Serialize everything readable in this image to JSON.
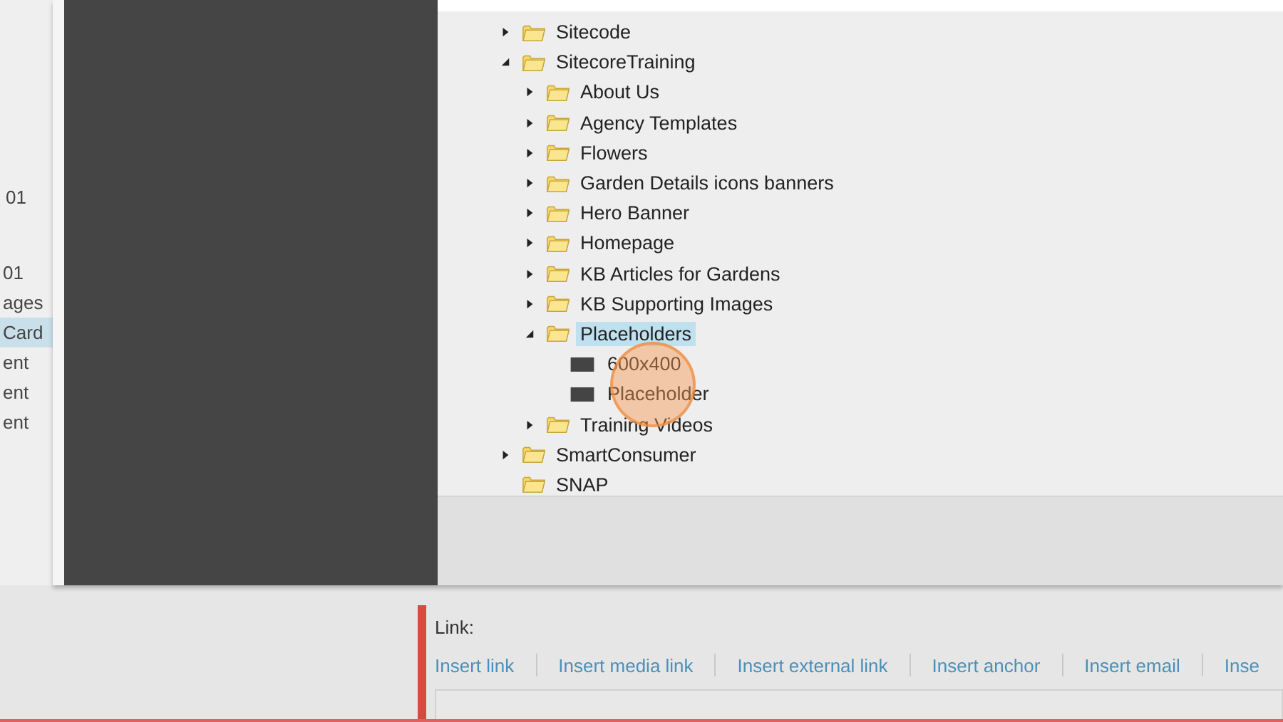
{
  "background_list": [
    {
      "label": "01",
      "selected": false
    },
    {
      "label": "01",
      "selected": false
    },
    {
      "label": "ages",
      "selected": false
    },
    {
      "label": "Card",
      "selected": true
    },
    {
      "label": "ent",
      "selected": false
    },
    {
      "label": "ent",
      "selected": false
    },
    {
      "label": "ent",
      "selected": false
    }
  ],
  "tree": [
    {
      "label": "Sitecode",
      "kind": "folder",
      "expanded": false,
      "selected": false
    },
    {
      "label": "SitecoreTraining",
      "kind": "folder",
      "expanded": true,
      "selected": false,
      "children": [
        {
          "label": "About Us",
          "kind": "folder",
          "expanded": false,
          "selected": false
        },
        {
          "label": "Agency Templates",
          "kind": "folder",
          "expanded": false,
          "selected": false
        },
        {
          "label": "Flowers",
          "kind": "folder",
          "expanded": false,
          "selected": false
        },
        {
          "label": "Garden Details icons banners",
          "kind": "folder",
          "expanded": false,
          "selected": false
        },
        {
          "label": "Hero Banner",
          "kind": "folder",
          "expanded": false,
          "selected": false
        },
        {
          "label": "Homepage",
          "kind": "folder",
          "expanded": false,
          "selected": false
        },
        {
          "label": "KB Articles for Gardens",
          "kind": "folder",
          "expanded": false,
          "selected": false
        },
        {
          "label": "KB Supporting Images",
          "kind": "folder",
          "expanded": false,
          "selected": false
        },
        {
          "label": "Placeholders",
          "kind": "folder",
          "expanded": true,
          "selected": true,
          "children": [
            {
              "label": "600x400",
              "kind": "image",
              "selected": false
            },
            {
              "label": "Placeholder",
              "kind": "image",
              "selected": false
            }
          ]
        },
        {
          "label": "Training Videos",
          "kind": "folder",
          "expanded": false,
          "selected": false
        }
      ]
    },
    {
      "label": "SmartConsumer",
      "kind": "folder",
      "expanded": false,
      "selected": false
    },
    {
      "label": "SNAP",
      "kind": "folder",
      "selected": false
    }
  ],
  "link_field": {
    "label": "Link:",
    "actions": [
      "Insert link",
      "Insert media link",
      "Insert external link",
      "Insert anchor",
      "Insert email",
      "Inse"
    ]
  }
}
